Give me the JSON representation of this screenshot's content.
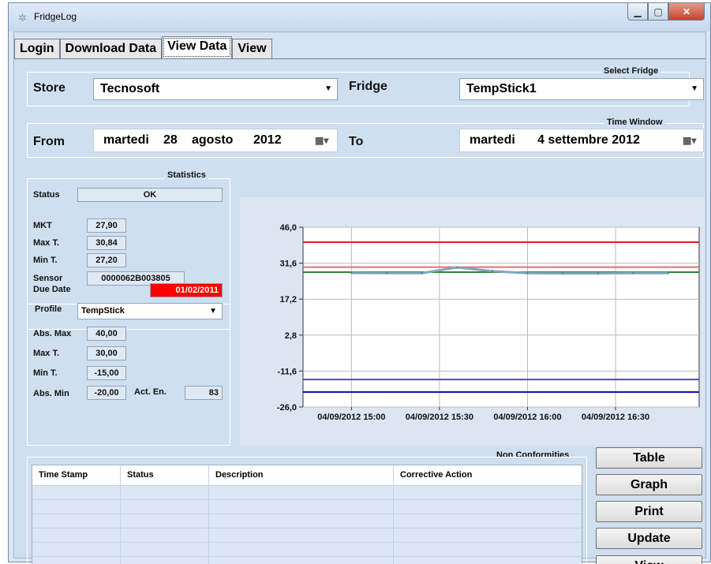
{
  "window": {
    "title": "FridgeLog"
  },
  "tabs": [
    {
      "label": "Login"
    },
    {
      "label": "Download Data"
    },
    {
      "label": "View Data"
    },
    {
      "label": "View"
    }
  ],
  "select_fridge": {
    "group_title": "Select Fridge",
    "store_label": "Store",
    "store_value": "Tecnosoft",
    "fridge_label": "Fridge",
    "fridge_value": "TempStick1"
  },
  "time_window": {
    "group_title": "Time Window",
    "from_label": "From",
    "from_day": "martedi",
    "from_date": "28",
    "from_month": "agosto",
    "from_year": "2012",
    "to_label": "To",
    "to_day": "martedi",
    "to_date": "4 settembre 2012"
  },
  "statistics": {
    "group_title": "Statistics",
    "status_label": "Status",
    "status_value": "OK",
    "mkt_label": "MKT",
    "mkt_value": "27,90",
    "maxt_label": "Max T.",
    "maxt_value": "30,84",
    "mint_label": "Min T.",
    "mint_value": "27,20",
    "sensor_label": "Sensor",
    "sensor_value": "0000062B003805",
    "due_label": "Due Date",
    "due_value": "01/02/2011",
    "due_color": "#ff0000"
  },
  "profile": {
    "label": "Profile",
    "value": "TempStick",
    "absmax_label": "Abs. Max",
    "absmax_value": "40,00",
    "maxt_label": "Max T.",
    "maxt_value": "30,00",
    "mint_label": "Min T.",
    "mint_value": "-15,00",
    "absmin_label": "Abs. Min",
    "absmin_value": "-20,00",
    "acten_label": "Act. En.",
    "acten_value": "83"
  },
  "chart_data": {
    "type": "line",
    "ylim": [
      -26.0,
      46.0
    ],
    "yticks": [
      "46,0",
      "31,6",
      "17,2",
      "2,8",
      "-11,6",
      "-26,0"
    ],
    "xticks": [
      "04/09/2012 15:00",
      "04/09/2012 15:30",
      "04/09/2012 16:00",
      "04/09/2012 16:30"
    ],
    "grid": true,
    "reference_lines": [
      {
        "value": 40.0,
        "color": "#e02020"
      },
      {
        "value": 30.0,
        "color": "#e07070"
      },
      {
        "value": 28.0,
        "color": "#2a8a2a"
      },
      {
        "value": -15.0,
        "color": "#4848d8"
      },
      {
        "value": -20.0,
        "color": "#1010c0"
      }
    ],
    "series": [
      {
        "color": "#7fa7bf",
        "x": [
          0,
          0.4,
          0.8,
          1.2,
          1.6,
          2.0,
          2.4,
          2.8,
          3.2,
          3.6
        ],
        "values": [
          27.7,
          27.6,
          27.6,
          29.9,
          28.4,
          27.6,
          27.5,
          27.5,
          27.6,
          27.6
        ]
      }
    ]
  },
  "non_conformities": {
    "group_title": "Non Conformities",
    "columns": [
      "Time Stamp",
      "Status",
      "Description",
      "Corrective Action"
    ]
  },
  "buttons": {
    "table": "Table",
    "graph": "Graph",
    "print": "Print",
    "update": "Update",
    "view": "View"
  }
}
